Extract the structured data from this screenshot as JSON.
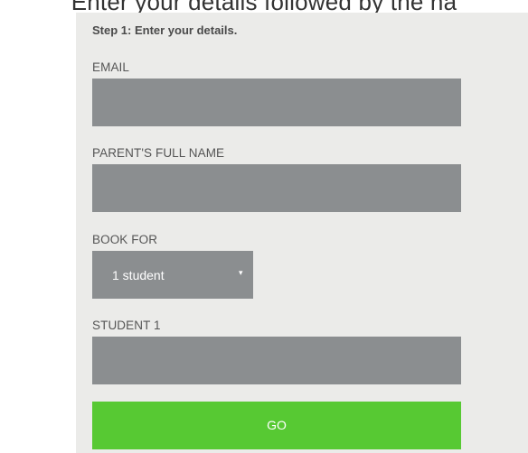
{
  "header": {
    "instruction": "Enter your details followed by the na"
  },
  "form": {
    "step_title": "Step 1: Enter your details.",
    "email": {
      "label": "EMAIL",
      "value": ""
    },
    "parent_name": {
      "label": "PARENT'S FULL NAME",
      "value": ""
    },
    "book_for": {
      "label": "BOOK FOR",
      "selected": "1 student",
      "caret": "▾"
    },
    "student_1": {
      "label": "STUDENT 1",
      "value": ""
    },
    "submit_label": "GO"
  },
  "colors": {
    "panel_bg": "#ebebe9",
    "input_bg": "#8b8e90",
    "button_bg": "#57c933"
  }
}
